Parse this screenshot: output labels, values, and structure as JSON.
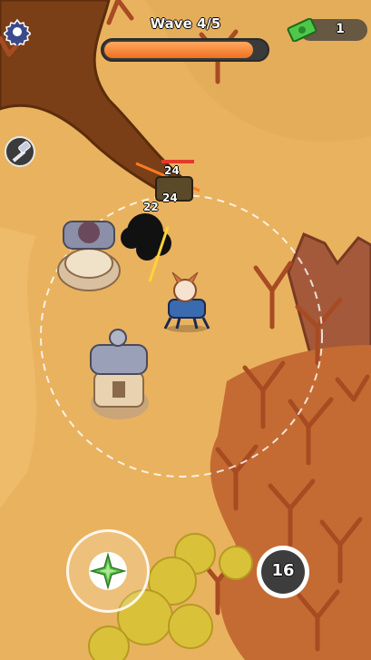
{
  "hud": {
    "wave_label": "Wave 4/5",
    "wave_progress": 0.92,
    "money": "1",
    "settings_icon": "gear-icon",
    "money_icon": "cash-icon",
    "build_icon": "hammer-icon"
  },
  "damage_numbers": [
    "24",
    "24",
    "22"
  ],
  "controls": {
    "joystick_icon": "compass-star-icon",
    "skill_icon": "bomb-icon",
    "skill_count": "16"
  },
  "colors": {
    "ground": "#e9b25f",
    "path": "#8a4a1c",
    "wave_bar_fill": "#f07020",
    "money_green": "#4fc84a",
    "tree": "#b45a2a",
    "bush": "#d9c23a"
  }
}
